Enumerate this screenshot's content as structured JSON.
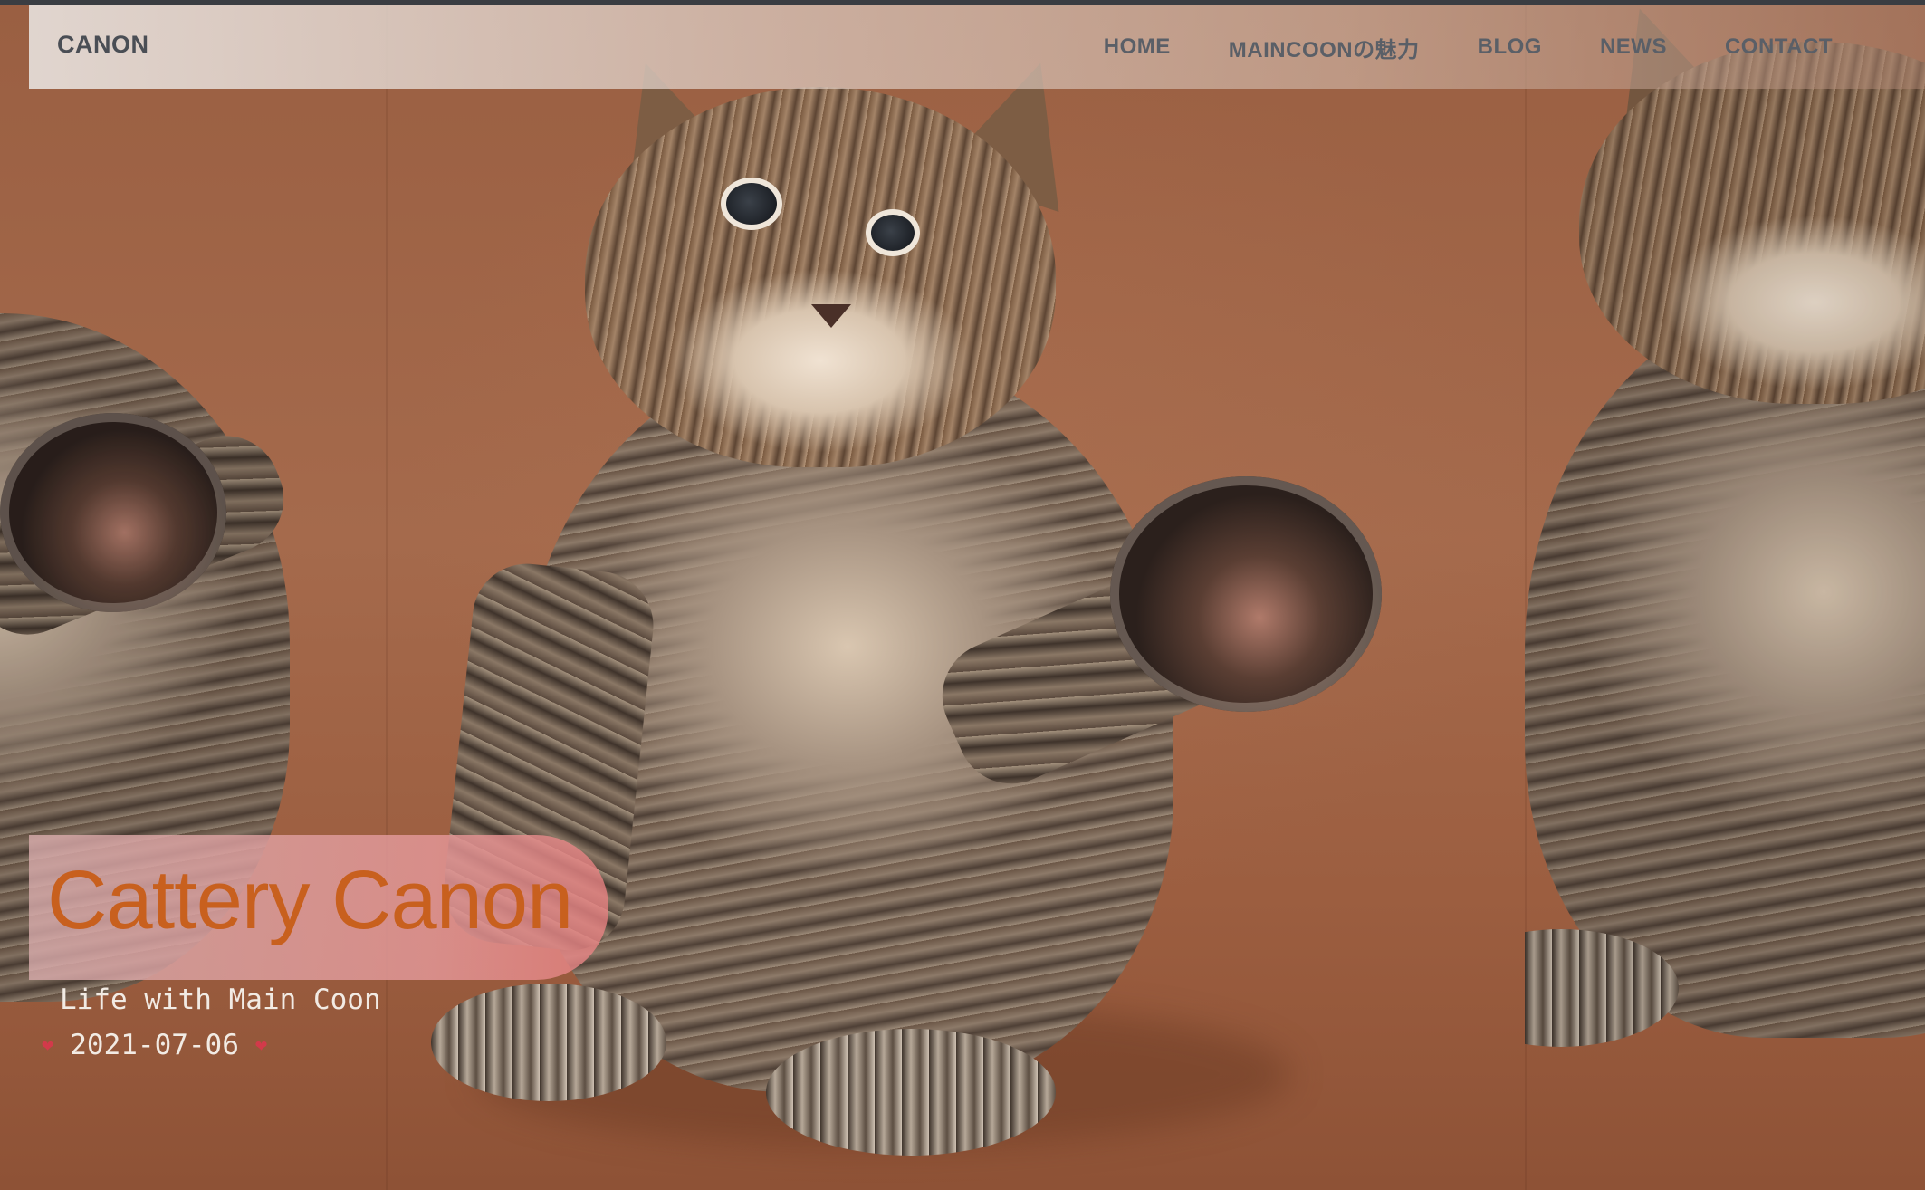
{
  "navbar": {
    "brand": "CANON",
    "links": [
      {
        "label": "HOME"
      },
      {
        "label": "MAINCOONの魅力"
      },
      {
        "label": "BLOG"
      },
      {
        "label": "NEWS"
      },
      {
        "label": "CONTACT"
      }
    ]
  },
  "hero": {
    "title": "Cattery Canon",
    "subtitle": "Life with Main Coon",
    "date": "2021-07-06",
    "heart_glyph": "❤",
    "background_image": "maine-coon-kitten-photo"
  },
  "colors": {
    "title": "#c8601e",
    "title_box": "#e2a0a0",
    "heart": "#d23a4a",
    "nav_text": "#5a5f67",
    "background": "#9b6142"
  },
  "icons": {
    "heart": "heart-icon"
  }
}
